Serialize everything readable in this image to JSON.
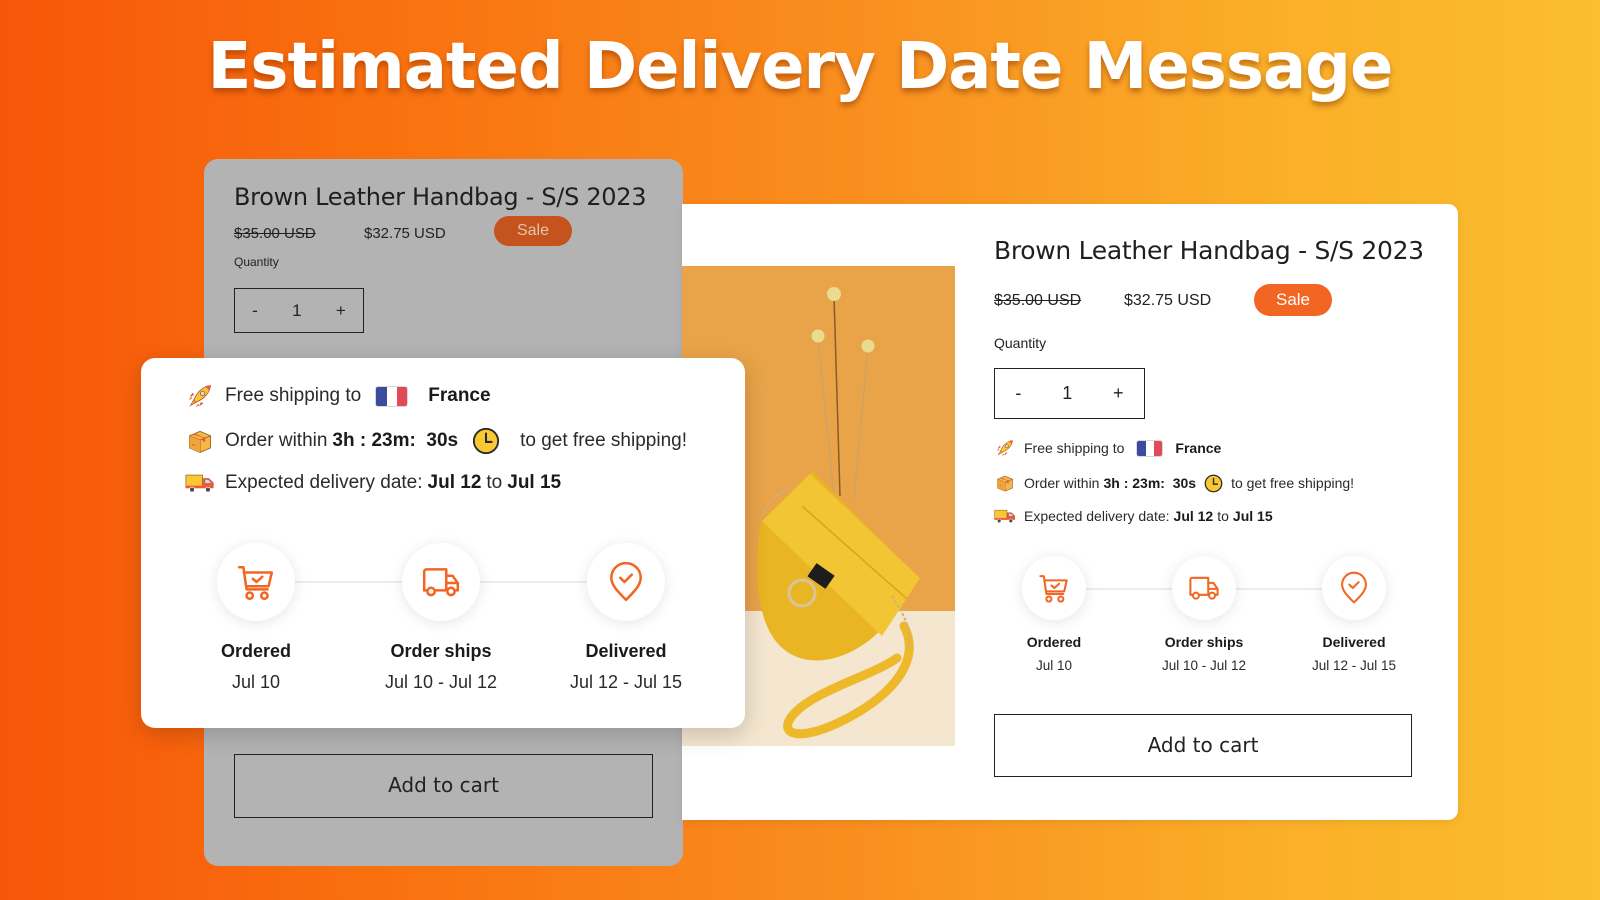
{
  "header": {
    "title": "Estimated Delivery Date Message"
  },
  "colors": {
    "gradient_start": "#F7560A",
    "gradient_end": "#FBBE2E",
    "accent": "#F26522",
    "sale_badge_dimmed": "#C4531D",
    "dimmed_card": "#B3B3B3",
    "flag_blue": "#3B4BA0",
    "flag_white": "#FFFFFF",
    "flag_red": "#E24A57"
  },
  "product": {
    "title": "Brown Leather Handbag - S/S 2023",
    "original_price": "$35.00 USD",
    "sale_price": "$32.75 USD",
    "badge": "Sale",
    "quantity_label": "Quantity",
    "quantity_value": "1",
    "decrement_label": "-",
    "increment_label": "+",
    "add_to_cart_label": "Add to cart"
  },
  "shipping": {
    "free_shipping_prefix": "Free shipping to",
    "country": "France",
    "country_flag": "flag-france",
    "order_within_prefix": "Order within",
    "countdown": "3h : 23m:  30s",
    "order_within_suffix": "to get free shipping!",
    "expected_prefix": "Expected delivery date:",
    "expected_from": "Jul 12",
    "expected_to_word": "to",
    "expected_to": "Jul 15",
    "icons": {
      "free_shipping": "rocket-icon",
      "order_within": "package-box-icon",
      "countdown": "clock-icon",
      "expected": "delivery-truck-icon"
    }
  },
  "timeline": [
    {
      "label": "Ordered",
      "date": "Jul 10",
      "icon": "cart-check-icon"
    },
    {
      "label": "Order ships",
      "date": "Jul 10 - Jul 12",
      "icon": "truck-icon"
    },
    {
      "label": "Delivered",
      "date": "Jul 12 - Jul 15",
      "icon": "location-check-icon"
    }
  ]
}
